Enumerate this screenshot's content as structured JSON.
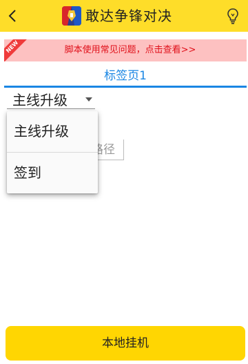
{
  "header": {
    "title": "敢达争锋对决",
    "back_icon": "chevron-left-icon",
    "help_icon": "lightbulb-icon",
    "background_color": "#fedd29"
  },
  "notice": {
    "badge": "NEW",
    "text": "脚本使用常见问题，点击查看>>",
    "text_color": "#e0101a",
    "background_color": "#fdc1c1"
  },
  "tabs": [
    {
      "label": "标签页1",
      "active": true
    }
  ],
  "select": {
    "value": "主线升级",
    "options": [
      "主线升级",
      "签到"
    ]
  },
  "path_field": {
    "visible_text": "路径"
  },
  "footer": {
    "run_label": "本地挂机",
    "button_color": "#ffd602"
  },
  "accent_color": "#1a86e3"
}
